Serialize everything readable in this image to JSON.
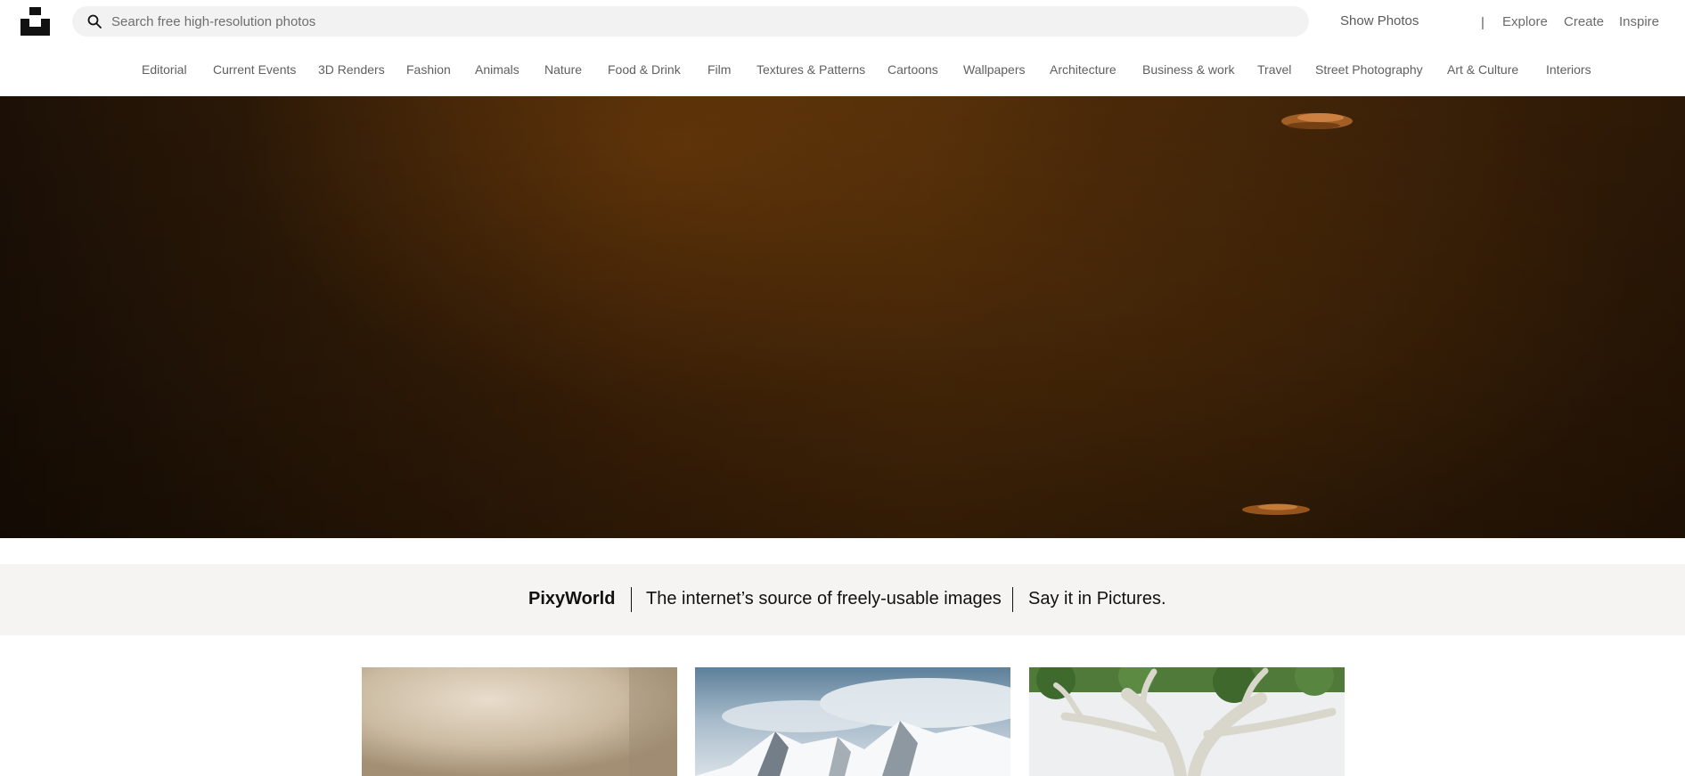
{
  "header": {
    "search_placeholder": "Search free high-resolution photos",
    "show_photos_label": "Show Photos",
    "divider": "|",
    "nav": [
      "Explore",
      "Create",
      "Inspire"
    ]
  },
  "categories": [
    "Editorial",
    "Current Events",
    "3D Renders",
    "Fashion",
    "Animals",
    "Nature",
    "Food & Drink",
    "Film",
    "Textures & Patterns",
    "Cartoons",
    "Wallpapers",
    "Architecture",
    "Business & work",
    "Travel",
    "Street Photography",
    "Art & Culture",
    "Interiors"
  ],
  "tagline": {
    "brand": "PixyWorld",
    "text": "The internet’s source of freely-usable images",
    "slogan": "Say it in Pictures."
  },
  "colors": {
    "search_bg": "#f2f2f2",
    "tagline_bg": "#f5f4f2",
    "hero_tone": "#4b2a09"
  },
  "icons": {
    "logo": "logo-icon",
    "search": "search-icon"
  }
}
